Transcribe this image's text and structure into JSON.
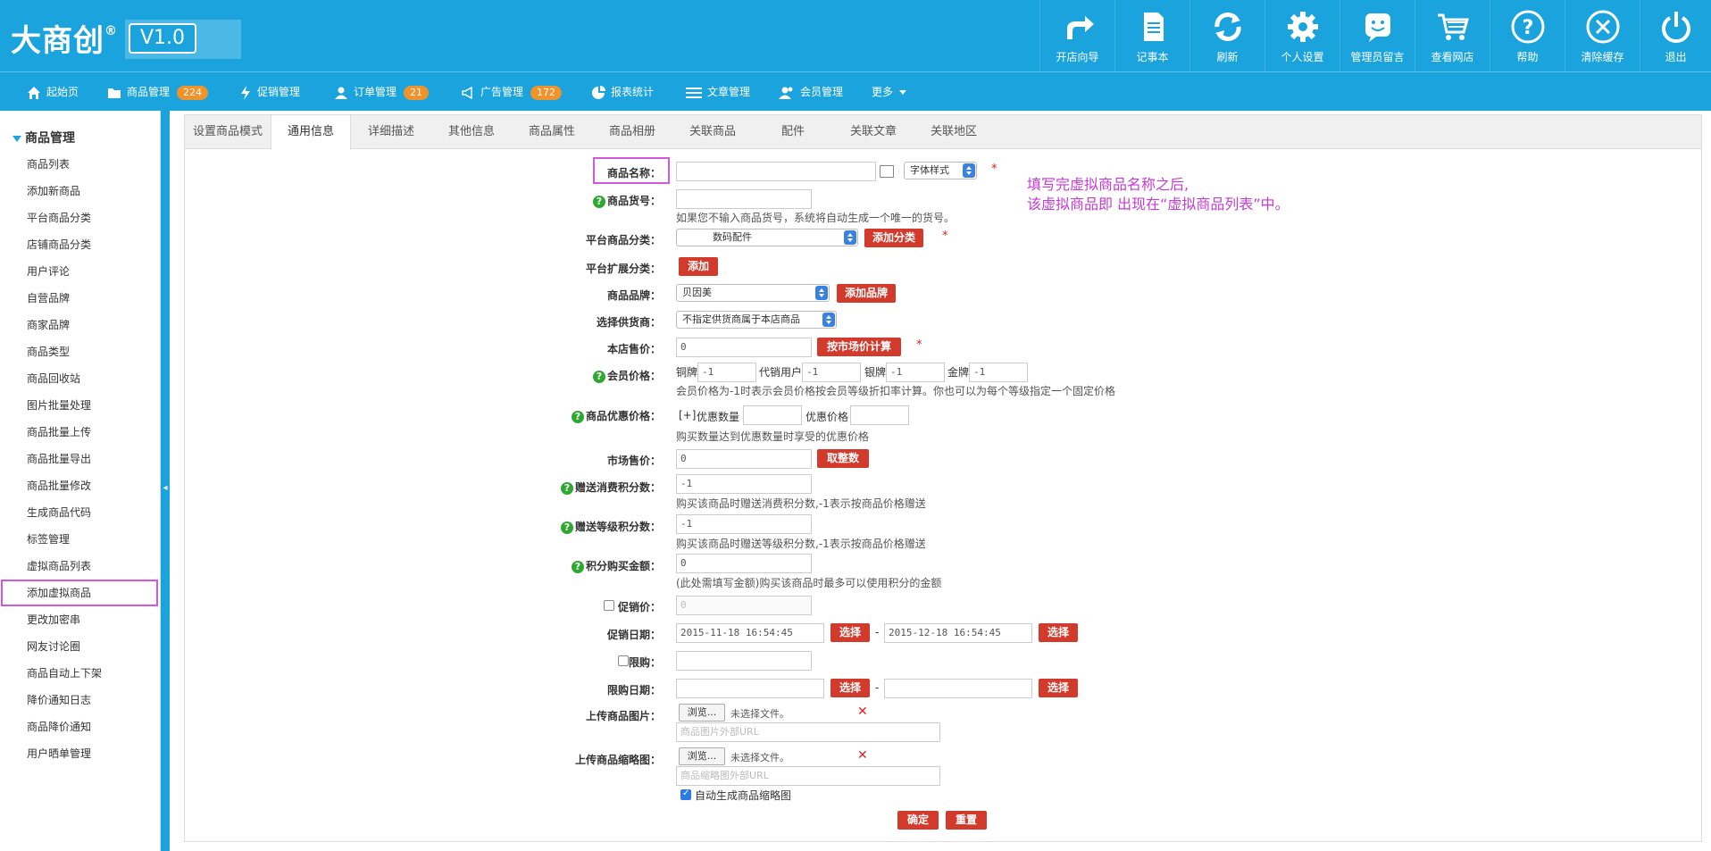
{
  "brand": {
    "logo": "大商创",
    "reg": "®",
    "version": "V1.0"
  },
  "toolbar": [
    {
      "label": "开店向导",
      "icon": "redirect-arrow-icon"
    },
    {
      "label": "记事本",
      "icon": "notepad-icon"
    },
    {
      "label": "刷新",
      "icon": "refresh-icon"
    },
    {
      "label": "个人设置",
      "icon": "gear-icon"
    },
    {
      "label": "管理员留言",
      "icon": "chat-icon"
    },
    {
      "label": "查看网店",
      "icon": "cart-icon"
    },
    {
      "label": "帮助",
      "icon": "help-icon"
    },
    {
      "label": "清除缓存",
      "icon": "clear-icon"
    },
    {
      "label": "退出",
      "icon": "power-icon"
    }
  ],
  "nav": [
    {
      "label": "起始页",
      "icon": "home-icon"
    },
    {
      "label": "商品管理",
      "icon": "folder-icon",
      "badge": "224"
    },
    {
      "label": "促销管理",
      "icon": "lightning-icon"
    },
    {
      "label": "订单管理",
      "icon": "user-icon",
      "badge": "21"
    },
    {
      "label": "广告管理",
      "icon": "megaphone-icon",
      "badge": "172"
    },
    {
      "label": "报表统计",
      "icon": "chart-icon"
    },
    {
      "label": "文章管理",
      "icon": "list-icon"
    },
    {
      "label": "会员管理",
      "icon": "users-icon"
    },
    {
      "label": "更多",
      "icon": "caret-down-icon"
    }
  ],
  "sidebar": {
    "title": "商品管理",
    "items": [
      "商品列表",
      "添加新商品",
      "平台商品分类",
      "店铺商品分类",
      "用户评论",
      "自营品牌",
      "商家品牌",
      "商品类型",
      "商品回收站",
      "图片批量处理",
      "商品批量上传",
      "商品批量导出",
      "商品批量修改",
      "生成商品代码",
      "标签管理",
      "虚拟商品列表",
      "添加虚拟商品",
      "更改加密串",
      "网友讨论圈",
      "商品自动上下架",
      "降价通知日志",
      "商品降价通知",
      "用户晒单管理"
    ]
  },
  "tabs": [
    "设置商品模式",
    "通用信息",
    "详细描述",
    "其他信息",
    "商品属性",
    "商品相册",
    "关联商品",
    "配件",
    "关联文章",
    "关联地区"
  ],
  "form": {
    "name_label": "商品名称：",
    "font_style": "字体样式",
    "sn_label": "商品货号：",
    "sn_hint": "如果您不输入商品货号，系统将自动生成一个唯一的货号。",
    "cat_label": "平台商品分类：",
    "cat_value": "数码配件",
    "add_cat": "添加分类",
    "ext_label": "平台扩展分类：",
    "add": "添加",
    "brand_label": "商品品牌：",
    "brand_value": "贝因美",
    "add_brand": "添加品牌",
    "supplier_label": "选择供货商：",
    "supplier_value": "不指定供货商属于本店商品",
    "shop_price_label": "本店售价：",
    "shop_price": "0",
    "calc_market": "按市场价计算",
    "member_label": "会员价格：",
    "member_levels": [
      {
        "name": "铜牌",
        "value": "-1"
      },
      {
        "name": "代销用户",
        "value": "-1"
      },
      {
        "name": "银牌",
        "value": "-1"
      },
      {
        "name": "金牌",
        "value": "-1"
      }
    ],
    "member_hint": "会员价格为-1时表示会员价格按会员等级折扣率计算。你也可以为每个等级指定一个固定价格",
    "volume_label": "商品优惠价格：",
    "volume_add": "[+]",
    "volume_qty": "优惠数量",
    "volume_price": "优惠价格",
    "volume_hint": "购买数量达到优惠数量时享受的优惠价格",
    "market_label": "市场售价：",
    "market_price": "0",
    "round": "取整数",
    "give_label": "赠送消费积分数：",
    "give_value": "-1",
    "give_hint": "购买该商品时赠送消费积分数,-1表示按商品价格赠送",
    "rank_label": "赠送等级积分数：",
    "rank_value": "-1",
    "rank_hint": "购买该商品时赠送等级积分数,-1表示按商品价格赠送",
    "integral_label": "积分购买金额：",
    "integral_value": "0",
    "integral_hint": "(此处需填写金额)购买该商品时最多可以使用积分的金额",
    "promote_label": "促销价：",
    "promote_value": "0",
    "promote_date_label": "促销日期：",
    "promote_start": "2015-11-18 16:54:45",
    "promote_end": "2015-12-18 16:54:45",
    "choose": "选择",
    "dash": "-",
    "limit_label": "限购：",
    "limit_date_label": "限购日期：",
    "img_label": "上传商品图片：",
    "thumb_label": "上传商品缩略图：",
    "browse": "浏览...",
    "no_file": "未选择文件。",
    "img_url_ph": "商品图片外部URL",
    "thumb_url_ph": "商品缩略图外部URL",
    "auto_thumb": "自动生成商品缩略图",
    "ok": "确定",
    "reset": "重置",
    "required": "*",
    "help": "?"
  },
  "annotation": {
    "line1": "填写完虚拟商品名称之后,",
    "line2": "该虚拟商品即 出现在“虚拟商品列表”中。"
  },
  "colors": {
    "header": "#1aa3dd",
    "badge": "#f0932b",
    "danger": "#d23a2c",
    "highlight": "#d457e0",
    "annotation": "#c53ad4",
    "help": "#2ea830"
  }
}
